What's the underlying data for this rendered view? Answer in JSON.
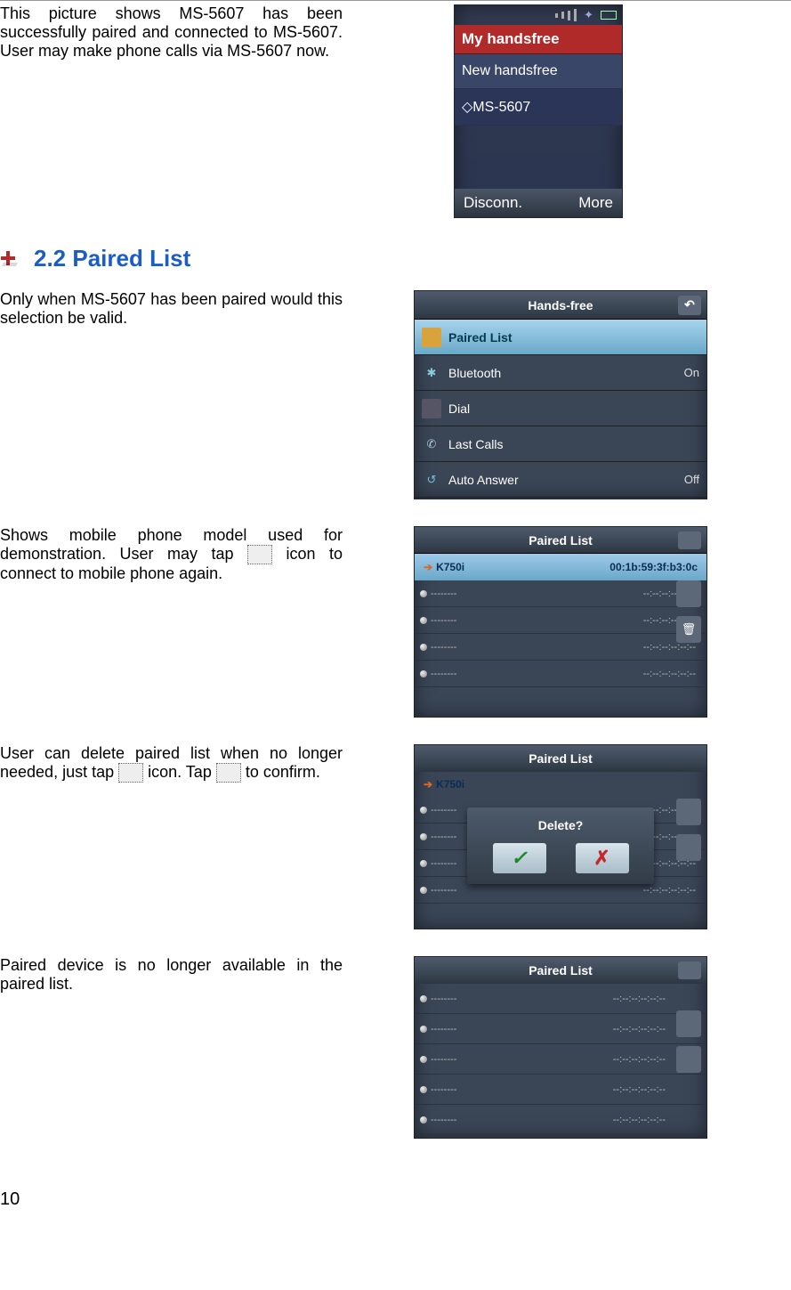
{
  "page_number": "10",
  "section1": {
    "text": "This picture shows MS-5607 has been successfully paired and connected to MS-5607.   User may make phone calls via MS-5607 now.",
    "device": {
      "title": "My handsfree",
      "item_new": "New handsfree",
      "item_paired": "◇MS-5607",
      "softkey_left": "Disconn.",
      "softkey_right": "More"
    }
  },
  "heading": "2.2 Paired List",
  "section2": {
    "text": "Only when MS-5607 has been paired would this selection be valid.",
    "device": {
      "header": "Hands-free",
      "rows": [
        {
          "label": "Paired List"
        },
        {
          "label": "Bluetooth",
          "value": "On"
        },
        {
          "label": "Dial"
        },
        {
          "label": "Last Calls"
        },
        {
          "label": "Auto Answer",
          "value": "Off"
        }
      ]
    }
  },
  "section3": {
    "text_before": "Shows mobile phone model used for demonstration.   User may tap ",
    "text_after": " icon to connect to mobile phone again.",
    "device": {
      "header": "Paired List",
      "top_name": "K750i",
      "top_addr": "00:1b:59:3f:b3:0c",
      "empty_name": "--------",
      "empty_addr": "--:--:--:--:--:--"
    }
  },
  "section4": {
    "text_before": "User can delete paired list when no longer needed, just tap ",
    "text_mid": " icon.   Tap ",
    "text_after": " to confirm.",
    "device": {
      "header": "Paired List",
      "top_name": "K750i",
      "dialog_text": "Delete?",
      "check": "✓",
      "cross": "✗",
      "empty_name": "--------",
      "empty_addr": "--:--:--:--:--:--"
    }
  },
  "section5": {
    "text": "Paired device is no longer available in the paired list.",
    "device": {
      "header": "Paired List",
      "empty_name": "--------",
      "empty_addr": "--:--:--:--:--:--"
    }
  }
}
